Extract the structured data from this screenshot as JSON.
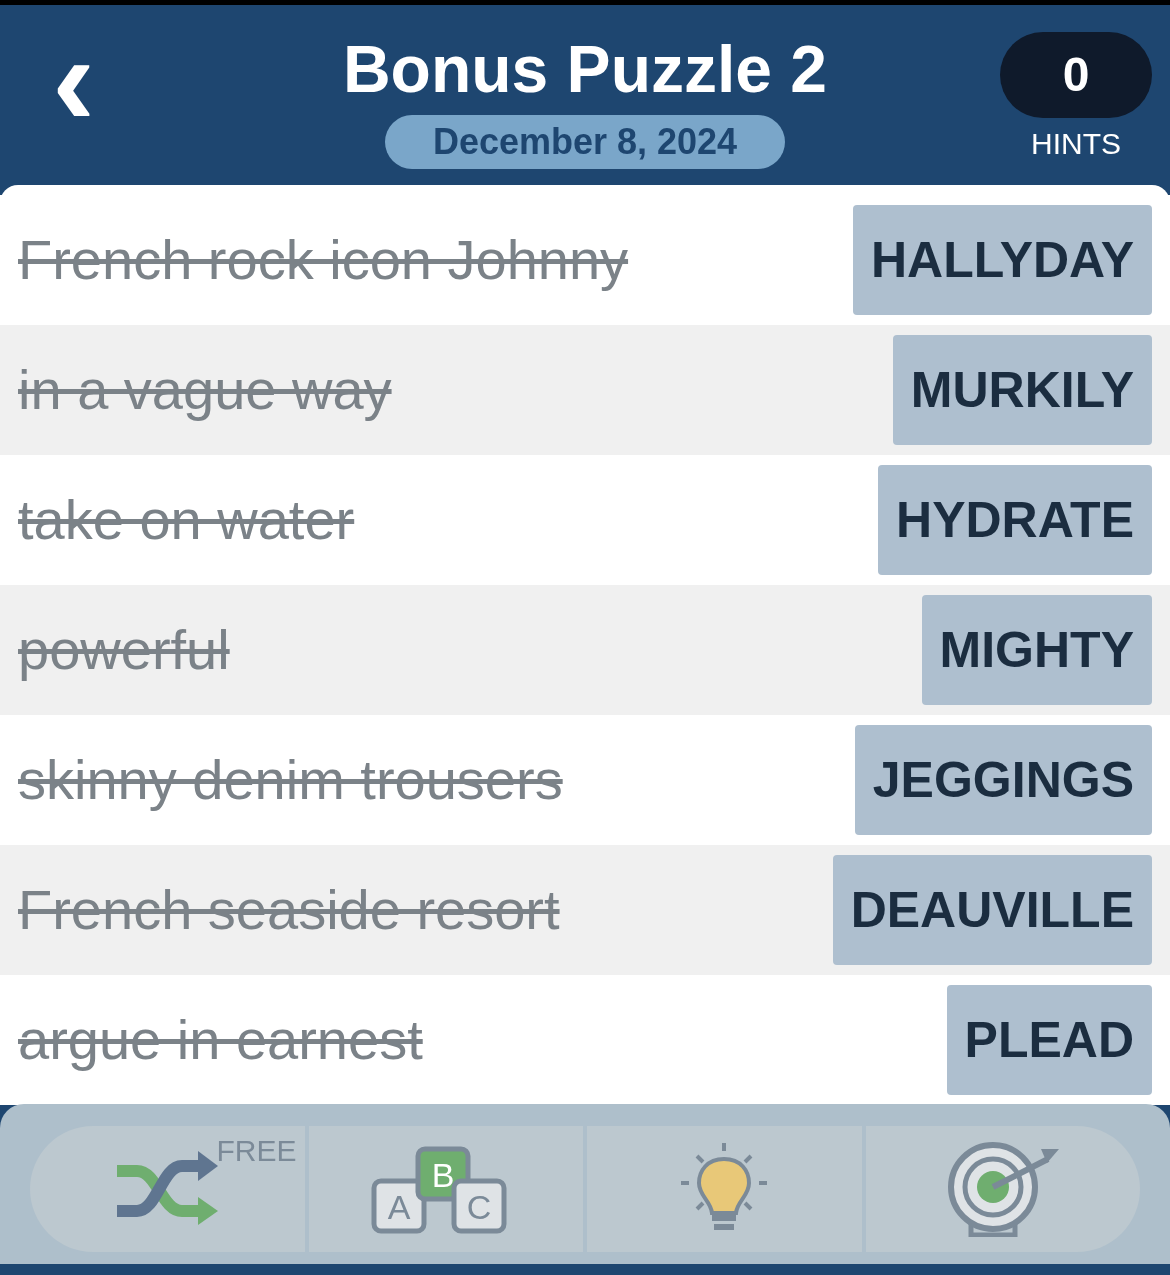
{
  "header": {
    "back": "‹",
    "title": "Bonus Puzzle 2",
    "date": "December 8, 2024",
    "hints": {
      "count": "0",
      "label": "HINTS"
    }
  },
  "clues": [
    {
      "clue": "French rock icon Johnny",
      "answer": "HALLYDAY",
      "solved": true
    },
    {
      "clue": "in a vague way",
      "answer": "MURKILY",
      "solved": true
    },
    {
      "clue": "take on water",
      "answer": "HYDRATE",
      "solved": true
    },
    {
      "clue": "powerful",
      "answer": "MIGHTY",
      "solved": true
    },
    {
      "clue": "skinny denim trousers",
      "answer": "JEGGINGS",
      "solved": true
    },
    {
      "clue": "French seaside resort",
      "answer": "DEAUVILLE",
      "solved": true
    },
    {
      "clue": "argue in earnest",
      "answer": "PLEAD",
      "solved": true
    }
  ],
  "tools": [
    {
      "kind": "shuffle",
      "badge": "FREE"
    },
    {
      "kind": "letters",
      "letters": [
        "A",
        "B",
        "C"
      ]
    },
    {
      "kind": "hint"
    },
    {
      "kind": "target"
    }
  ]
}
